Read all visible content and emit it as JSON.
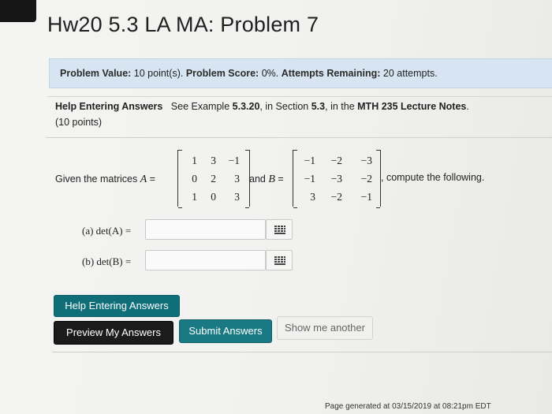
{
  "page": {
    "title": "Hw20 5.3 LA MA: Problem 7"
  },
  "info_bar": {
    "value_label": "Problem Value:",
    "value_text": "10 point(s).",
    "score_label": "Problem Score:",
    "score_text": "0%.",
    "attempts_label": "Attempts Remaining:",
    "attempts_text": "20 attempts."
  },
  "help": {
    "label": "Help Entering Answers",
    "see_text": "See Example",
    "example": "5.3.20",
    "in_section_text": ", in Section",
    "section": "5.3",
    "in_the_text": ", in the",
    "notes": "MTH 235 Lecture Notes",
    "period": ".",
    "points": "(10 points)"
  },
  "problem": {
    "given_text": "Given the matrices",
    "matrix_a_name": "A",
    "equals": "=",
    "and_text": "and",
    "matrix_b_name": "B",
    "compute_text": ", compute the following.",
    "matrix_a": [
      [
        "1",
        "3",
        "−1"
      ],
      [
        "0",
        "2",
        "3"
      ],
      [
        "1",
        "0",
        "3"
      ]
    ],
    "matrix_b": [
      [
        "−1",
        "−2",
        "−3"
      ],
      [
        "−1",
        "−3",
        "−2"
      ],
      [
        "3",
        "−2",
        "−1"
      ]
    ]
  },
  "questions": [
    {
      "label": "(a) det(A) =",
      "value": "",
      "icon": "grid-icon"
    },
    {
      "label": "(b) det(B) =",
      "value": "",
      "icon": "grid-icon"
    }
  ],
  "buttons": {
    "help": "Help Entering Answers",
    "preview": "Preview My Answers",
    "submit": "Submit Answers",
    "another": "Show me another"
  },
  "footer": {
    "text": "Page generated at 03/15/2019 at 08:21pm EDT"
  },
  "colors": {
    "info_bar": "#d6e5f1",
    "help_button": "#0f6e78",
    "preview_button": "#1b1b1b",
    "submit_button": "#1a7a84"
  }
}
